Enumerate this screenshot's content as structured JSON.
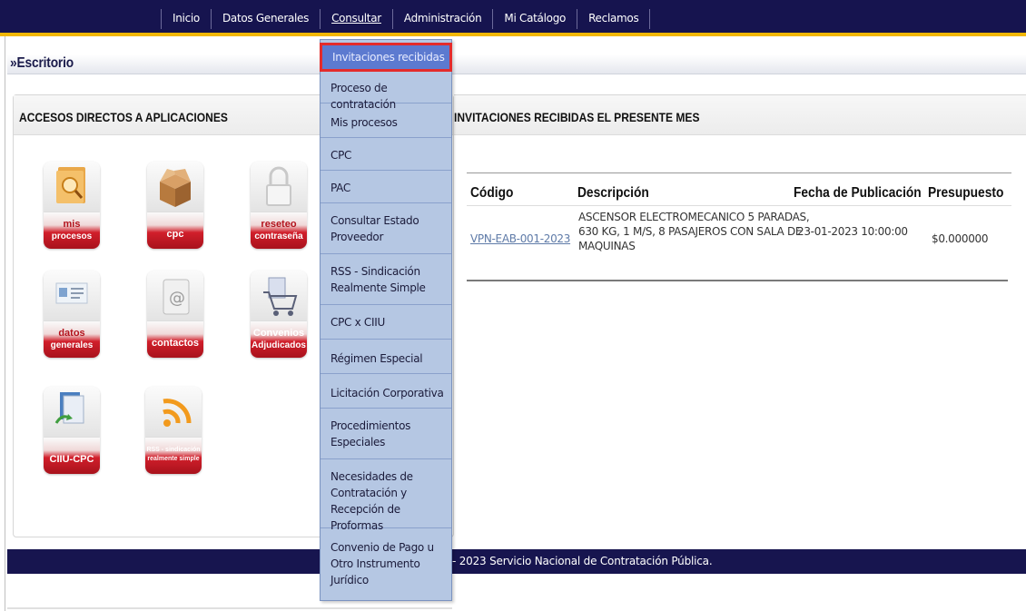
{
  "topnav": {
    "items": [
      {
        "label": "Inicio"
      },
      {
        "label": "Datos Generales"
      },
      {
        "label": "Consultar"
      },
      {
        "label": "Administración"
      },
      {
        "label": "Mi Catálogo"
      },
      {
        "label": "Reclamos"
      }
    ],
    "active": "Consultar"
  },
  "page": {
    "breadcrumb": "»Escritorio"
  },
  "left_panel": {
    "title": "ACCESOS DIRECTOS A APLICACIONES",
    "tiles": [
      {
        "line1": "mis",
        "line2": "procesos",
        "icon": "folder-search-icon"
      },
      {
        "line1": "",
        "line2": "cpc",
        "icon": "open-box-icon"
      },
      {
        "line1": "reseteo",
        "line2": "contraseña",
        "icon": "padlock-icon"
      },
      {
        "line1": "datos",
        "line2": "generales",
        "icon": "id-card-icon"
      },
      {
        "line1": "",
        "line2": "contactos",
        "icon": "address-book-icon"
      },
      {
        "line1": "Convenios",
        "line2": "Adjudicados",
        "icon": "shopping-cart-icon"
      },
      {
        "line1": "",
        "line2": "CIIU-CPC",
        "icon": "documents-icon"
      },
      {
        "line1": "RSS - sindicación",
        "line2": "realmente simple",
        "icon": "rss-icon"
      }
    ]
  },
  "dropdown": {
    "items": [
      {
        "label": "Invitaciones recibidas"
      },
      {
        "label": "Proceso de contratación"
      },
      {
        "label": "Mis procesos"
      },
      {
        "label": "CPC"
      },
      {
        "label": "PAC"
      },
      {
        "label": "Consultar Estado",
        "label2": "Proveedor"
      },
      {
        "label": "RSS - Sindicación",
        "label2": "Realmente Simple"
      },
      {
        "label": "CPC x CIIU"
      },
      {
        "label": "Régimen Especial"
      },
      {
        "label": "Licitación Corporativa"
      },
      {
        "label": "Procedimientos",
        "label2": "Especiales"
      },
      {
        "label": "Necesidades de",
        "label2": "Contratación y",
        "label3": "Recepción de Proformas"
      },
      {
        "label": "Convenio de Pago u",
        "label2": "Otro Instrumento",
        "label3": "Jurídico"
      }
    ],
    "highlighted": "Invitaciones recibidas"
  },
  "right_panel": {
    "title": "INVITACIONES RECIBIDAS EL PRESENTE MES",
    "table": {
      "headers": [
        "Código",
        "Descripción",
        "Fecha de Publicación",
        "Presupuesto"
      ],
      "rows": [
        {
          "codigo": "VPN-EAB-001-2023",
          "descripcion": [
            "ASCENSOR ELECTROMECANICO 5 PARADAS,",
            "630 KG, 1 M/S, 8 PASAJEROS CON SALA DE",
            "MAQUINAS"
          ],
          "fecha": "23-01-2023 10:00:00",
          "presupuesto": "$0.000000"
        }
      ]
    }
  },
  "footer": {
    "text": "- 2023 Servicio Nacional de Contratación Pública."
  },
  "colors": {
    "nav_bg": "#16144f",
    "nav_accent": "#f2b705",
    "menu_bg": "#b5c7e3",
    "menu_highlight": "#5c7ad0",
    "highlight_border": "#e42b2b",
    "tile_red": "#d11f2b"
  }
}
